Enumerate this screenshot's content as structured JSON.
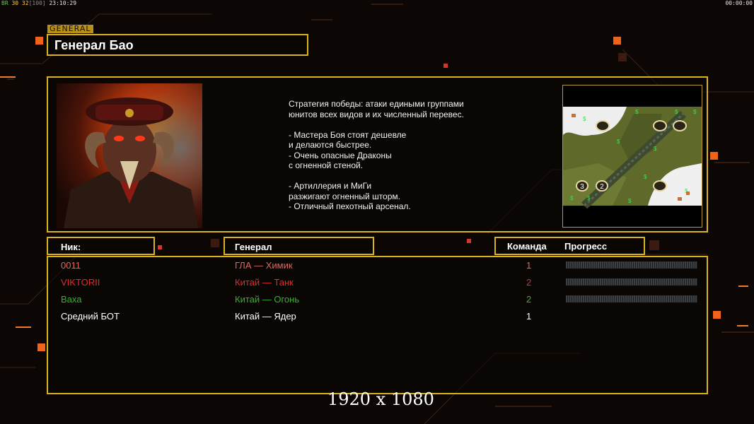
{
  "status_bar": {
    "left_prefix": "BR",
    "left_values": "30 32",
    "left_bracket": "[100]",
    "clock": "23:10:29",
    "timer": "00:00:00"
  },
  "general_tag": "GENERAL",
  "general_name": "Генерал Бао",
  "description": "Стратегия победы: атаки едиными группами\nюнитов всех видов и их численный перевес.\n\n- Мастера Боя стоят дешевле\nи делаются быстрее.\n- Очень опасные Драконы\nс огненной стеной.\n\n- Артиллерия и МиГи\nразжигают огненный шторм.\n- Отличный пехотный арсенал.",
  "map": {
    "slot_labels": [
      "3",
      "2"
    ]
  },
  "table": {
    "headers": {
      "nick": "Ник:",
      "general": "Генерал",
      "team": "Команда",
      "progress": "Прогресс"
    },
    "players": [
      {
        "nick": "0011",
        "general": "ГЛА — Химик",
        "team": "1",
        "color": "#e0675b",
        "progress": 0
      },
      {
        "nick": "VIKTORII",
        "general": "Китай — Танк",
        "team": "2",
        "color": "#e32b2b",
        "progress": 0
      },
      {
        "nick": "Ваха",
        "general": "Китай — Огонь",
        "team": "2",
        "color": "#35b42d",
        "progress": 0
      },
      {
        "nick": "Средний БОТ",
        "general": "Китай — Ядер",
        "team": "1",
        "color": "#ffffff",
        "progress": null
      }
    ]
  },
  "resolution_text": "1920 x 1080",
  "colors": {
    "frame": "#d9b21e",
    "accent": "#f0631a",
    "background": "#0c0705"
  }
}
